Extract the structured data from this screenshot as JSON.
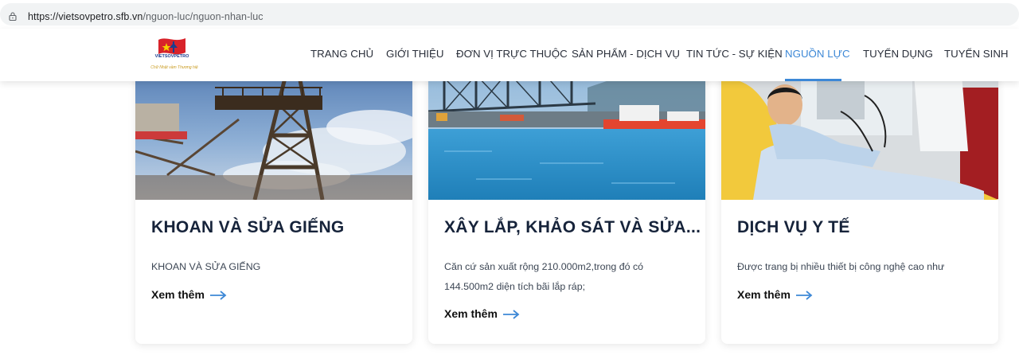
{
  "browser": {
    "url_host": "https://vietsovpetro.sfb.vn",
    "url_path": "/nguon-luc/nguon-nhan-luc"
  },
  "logo": {
    "title": "VIETSOVPETRO",
    "slogan": "Chữ Nhật vầm Thương hiệ"
  },
  "nav": {
    "items": [
      {
        "label": "TRANG CHỦ"
      },
      {
        "label": "GIỚI THIỆU"
      },
      {
        "label": "ĐƠN VỊ TRỰC THUỘC"
      },
      {
        "label": "SẢN PHẨM - DỊCH VỤ"
      },
      {
        "label": "TIN TỨC - SỰ KIỆN"
      },
      {
        "label": "NGUỒN LỰC"
      },
      {
        "label": "TUYỂN DỤNG"
      },
      {
        "label": "TUYỂN SINH"
      }
    ],
    "active_index": 5,
    "accent_color": "#3d88d6"
  },
  "cards": [
    {
      "title": "KHOAN VÀ SỬA GIẾNG",
      "text_lines": [
        "KHOAN VÀ SỬA GIẾNG"
      ],
      "more": "Xem thêm",
      "image": "drilling-rig-photo"
    },
    {
      "title": "XÂY LẮP, KHẢO SÁT VÀ SỬA...",
      "text_lines": [
        "Căn cứ sản xuất rộng 210.000m2,trong đó có",
        "144.500m2 diện tích bãi lắp ráp;"
      ],
      "more": "Xem thêm",
      "image": "shipyard-photo"
    },
    {
      "title": "DỊCH VỤ Y TẾ",
      "text_lines": [
        "Được trang bị nhiều thiết bị công nghệ cao như"
      ],
      "more": "Xem thêm",
      "image": "medical-photo"
    }
  ]
}
